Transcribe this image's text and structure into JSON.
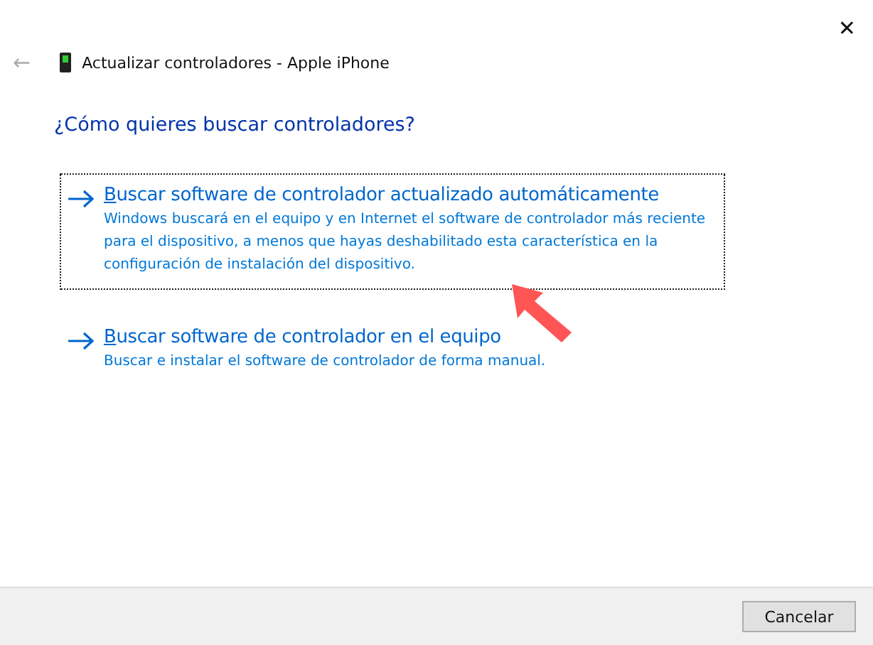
{
  "window": {
    "title": "Actualizar controladores - Apple iPhone",
    "close": "✕",
    "back": "←"
  },
  "heading": "¿Cómo quieres buscar controladores?",
  "options": [
    {
      "title": "Buscar software de controlador actualizado automáticamente",
      "description": "Windows buscará en el equipo y en Internet el software de controlador más reciente para el dispositivo, a menos que hayas deshabilitado esta característica en la configuración de instalación del dispositivo.",
      "selected": true
    },
    {
      "title": "Buscar software de controlador en el equipo",
      "description": "Buscar e instalar el software de controlador de forma manual.",
      "selected": false
    }
  ],
  "buttons": [
    "Cancelar"
  ]
}
